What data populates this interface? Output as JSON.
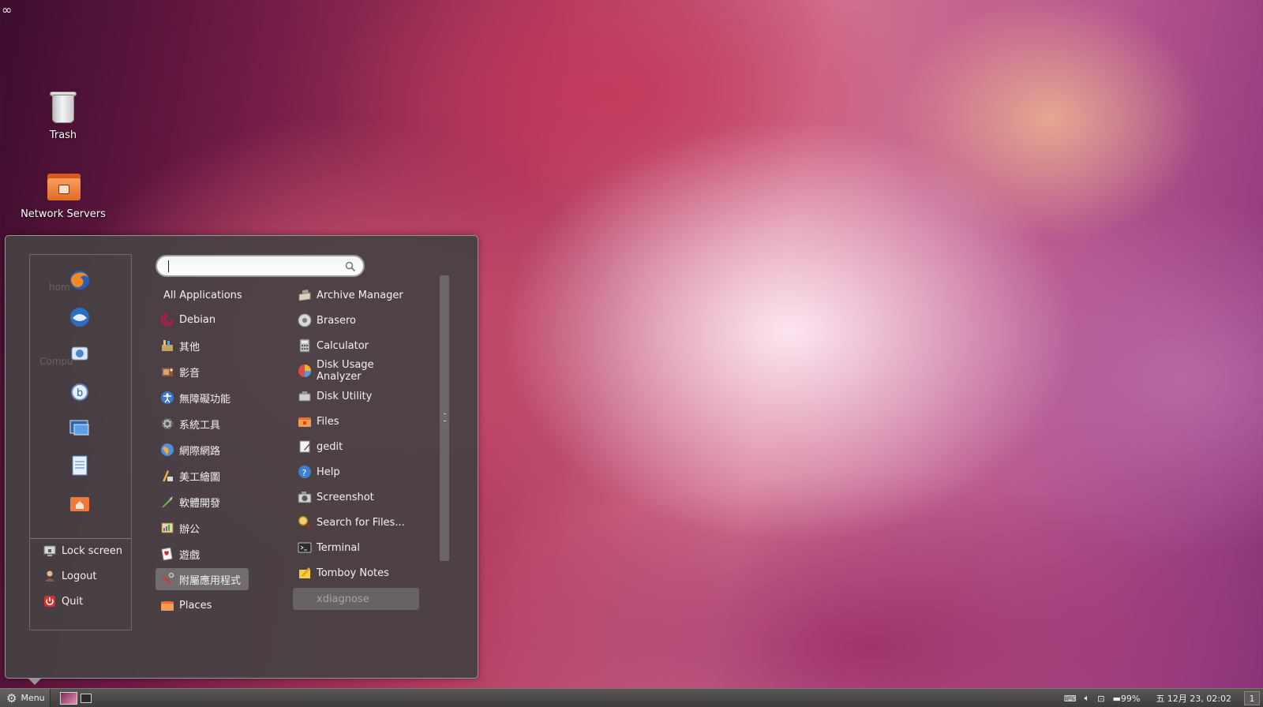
{
  "desktop": {
    "corner_glyph": "∞",
    "icons": [
      {
        "label": "Trash",
        "icon": "trash-icon"
      },
      {
        "label": "Network Servers",
        "icon": "network-folder-icon"
      }
    ],
    "obscured_icons": [
      {
        "label": "hom"
      },
      {
        "label": "Compu"
      }
    ]
  },
  "menu": {
    "search": {
      "placeholder": "",
      "value": ""
    },
    "favorites": [
      {
        "icon": "firefox-icon"
      },
      {
        "icon": "thunderbird-icon"
      },
      {
        "icon": "empathy-icon"
      },
      {
        "icon": "bluetooth-icon"
      },
      {
        "icon": "remote-desktop-icon"
      },
      {
        "icon": "document-icon"
      },
      {
        "icon": "home-folder-icon"
      }
    ],
    "session": [
      {
        "label": "Lock screen",
        "icon": "lock-screen-icon"
      },
      {
        "label": "Logout",
        "icon": "logout-icon"
      },
      {
        "label": "Quit",
        "icon": "quit-icon"
      }
    ],
    "categories": [
      {
        "label": "All Applications",
        "icon": ""
      },
      {
        "label": "Debian",
        "icon": "debian-icon"
      },
      {
        "label": "其他",
        "icon": "other-icon"
      },
      {
        "label": "影音",
        "icon": "multimedia-icon"
      },
      {
        "label": "無障礙功能",
        "icon": "accessibility-icon"
      },
      {
        "label": "系統工具",
        "icon": "system-tools-icon"
      },
      {
        "label": "網際網路",
        "icon": "internet-icon"
      },
      {
        "label": "美工繪圖",
        "icon": "graphics-icon"
      },
      {
        "label": "軟體開發",
        "icon": "development-icon"
      },
      {
        "label": "辦公",
        "icon": "office-icon"
      },
      {
        "label": "遊戲",
        "icon": "games-icon"
      },
      {
        "label": "附屬應用程式",
        "icon": "accessories-icon",
        "selected": true
      },
      {
        "label": "Places",
        "icon": "places-icon"
      }
    ],
    "apps": [
      {
        "label": "Archive Manager",
        "icon": "archive-manager-icon"
      },
      {
        "label": "Brasero",
        "icon": "brasero-icon"
      },
      {
        "label": "Calculator",
        "icon": "calculator-icon"
      },
      {
        "label": "Disk Usage Analyzer",
        "icon": "disk-usage-icon"
      },
      {
        "label": "Disk Utility",
        "icon": "disk-utility-icon"
      },
      {
        "label": "Files",
        "icon": "files-icon"
      },
      {
        "label": "gedit",
        "icon": "gedit-icon"
      },
      {
        "label": "Help",
        "icon": "help-icon"
      },
      {
        "label": "Screenshot",
        "icon": "screenshot-icon"
      },
      {
        "label": "Search for Files...",
        "icon": "search-files-icon"
      },
      {
        "label": "Terminal",
        "icon": "terminal-icon"
      },
      {
        "label": "Tomboy Notes",
        "icon": "tomboy-icon"
      },
      {
        "label": "xdiagnose",
        "icon": "",
        "dimmed": true
      }
    ]
  },
  "taskbar": {
    "menu_label": "Menu",
    "battery": "99%",
    "clock": "五 12月 23, 02:02",
    "workspace": "1",
    "colors": {
      "accent": "#e36a25",
      "panel": "#464244"
    }
  }
}
